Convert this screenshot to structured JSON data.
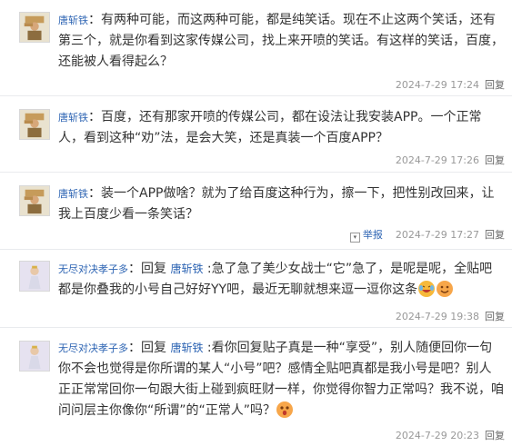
{
  "posts": [
    {
      "username": "唐斩铁",
      "text": "有两种可能，而这两种可能，都是纯笑话。现在不止这两个笑话，还有第三个，就是你看到这家传媒公司，找上来开喷的笑话。有这样的笑话，百度，还能被人看得起么？",
      "time": "2024-7-29 17:24",
      "reply_label": "回复"
    },
    {
      "username": "唐斩铁",
      "text": "百度，还有那家开喷的传媒公司，都在设法让我安装APP。一个正常人，看到这种“劝”法，是会大笑，还是真装一个百度APP？",
      "time": "2024-7-29 17:26",
      "reply_label": "回复"
    },
    {
      "username": "唐斩铁",
      "text": "装一个APP做啥？就为了给百度这种行为，擦一下，把性别改回来，让我上百度少看一条笑话？",
      "report_label": "举报",
      "time": "2024-7-29 17:27",
      "reply_label": "回复"
    },
    {
      "username": "无尽对决孝子多",
      "reply_word": "回复",
      "target": "唐斩铁",
      "text": ":急了急了美少女战士“它”急了，是呢是呢，全贴吧都是你叠我的小号自己好好YY吧，最近无聊就想来逗一逗你这条",
      "time": "2024-7-29 19:38",
      "reply_label": "回复"
    },
    {
      "username": "无尽对决孝子多",
      "reply_word": "回复",
      "target": "唐斩铁",
      "text": ":看你回复贴子真是一种“享受”，别人随便回你一句你不会也觉得是你所谓的某人“小号”吧？感情全贴吧真都是我小号是吧？别人正正常常回你一句跟大街上碰到疯旺财一样，你觉得你智力正常吗？我不说，咱问问层主你像你“所谓”的“正常人”吗？",
      "time": "2024-7-29 20:23",
      "reply_label": "回复"
    }
  ],
  "icons": {
    "avatar_1": "worker-with-bricks-avatar",
    "avatar_2": "anime-figure-avatar",
    "emoji_1": "crying-laughing-emoji",
    "emoji_2": "grinning-emoji",
    "emoji_3": "shocked-emoji",
    "report": "report-dropdown-icon"
  },
  "colors": {
    "username": "#2d64b3",
    "meta": "#999999",
    "text": "#333333"
  }
}
